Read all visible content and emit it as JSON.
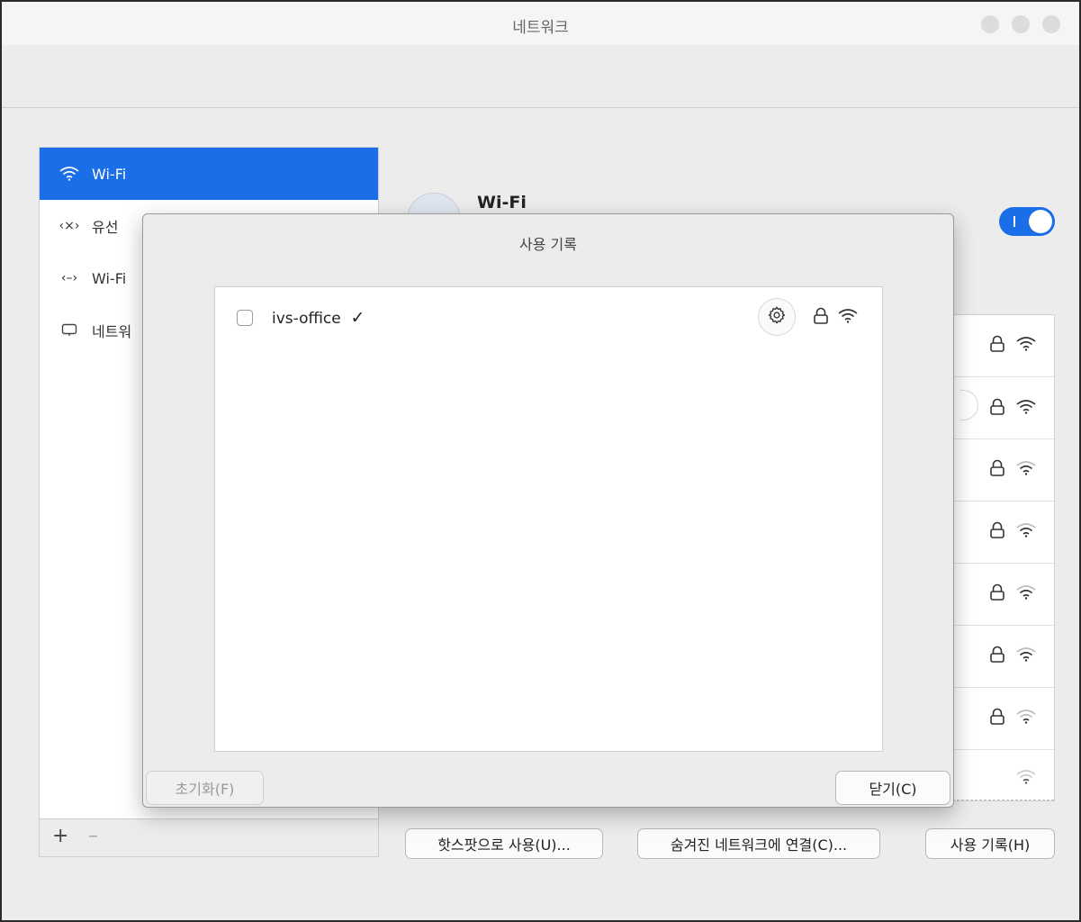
{
  "window": {
    "title": "네트워크"
  },
  "sidebar": {
    "items": [
      {
        "label": "Wi-Fi",
        "icon": "wifi-icon",
        "glyph": ""
      },
      {
        "label": "유선",
        "icon": "wired-disconnected-icon",
        "glyph": "‹×›"
      },
      {
        "label": "Wi-Fi",
        "icon": "wifi-direct-icon",
        "glyph": "‹–›"
      },
      {
        "label": "네트워",
        "icon": "monitor-icon",
        "glyph": ""
      }
    ],
    "add_label": "+",
    "remove_label": "–"
  },
  "main": {
    "header_title": "Wi-Fi",
    "toggle_on": true,
    "buttons": {
      "hotspot": "핫스팟으로 사용(U)...",
      "hidden": "숨겨진 네트워크에 연결(C)...",
      "history": "사용 기록(H)"
    }
  },
  "dialog": {
    "title": "사용 기록",
    "history": [
      {
        "name": "ivs-office",
        "checked": false,
        "connected_mark": "✓"
      }
    ],
    "reset_label": "초기화(F)",
    "close_label": "닫기(C)"
  },
  "colors": {
    "accent": "#1a6ee8",
    "window_bg": "#ececec",
    "list_bg": "#ffffff"
  }
}
